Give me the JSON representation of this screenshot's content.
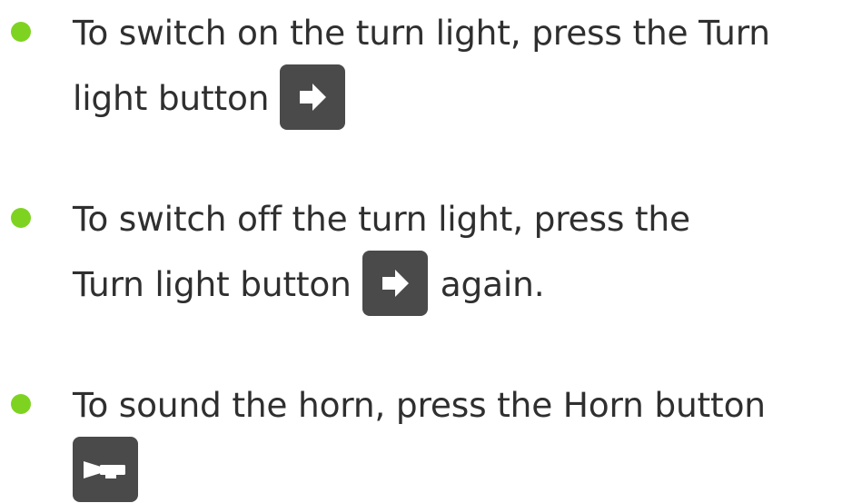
{
  "items": [
    {
      "line1": "To switch on the turn light, press the Turn",
      "line2": "light button",
      "icon": "turn-right-arrow-icon"
    },
    {
      "line1": "To switch off the turn light, press the",
      "line2": "Turn light button",
      "line2_after": "again.",
      "icon": "turn-right-arrow-icon"
    },
    {
      "line1": "To sound the horn, press the Horn button",
      "icon": "horn-icon"
    }
  ],
  "colors": {
    "bullet": "#7ed321",
    "text": "#2f2f2f",
    "icon_background": "#4a4a4a",
    "icon_glyph": "#ffffff"
  }
}
